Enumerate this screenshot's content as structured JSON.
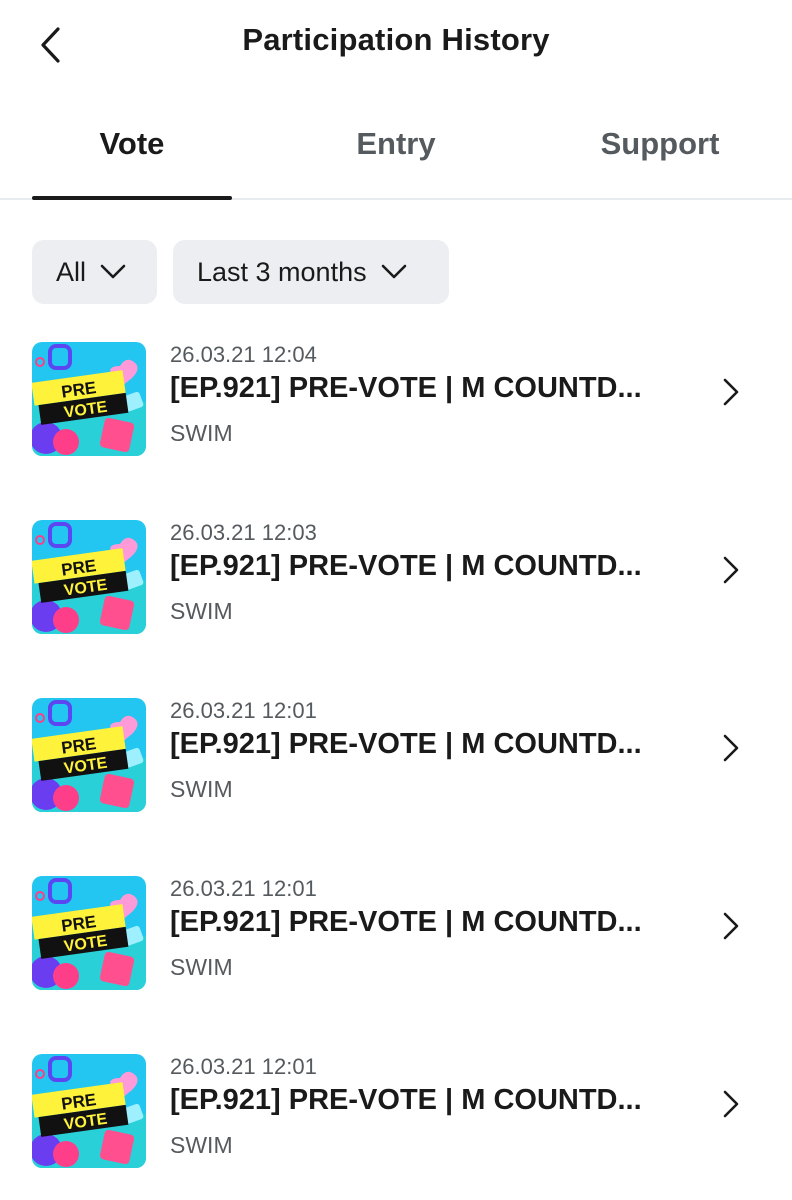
{
  "header": {
    "title": "Participation History",
    "back_icon": "chevron-left-icon"
  },
  "tabs": [
    {
      "label": "Vote",
      "active": true
    },
    {
      "label": "Entry",
      "active": false
    },
    {
      "label": "Support",
      "active": false
    }
  ],
  "filters": {
    "category": "All",
    "period": "Last 3 months",
    "icon": "chevron-down-icon"
  },
  "thumbnail": {
    "line1": "PRE",
    "line2": "VOTE"
  },
  "items": [
    {
      "date": "26.03.21 12:04",
      "title": "[EP.921] PRE-VOTE | M COUNTD...",
      "subtitle": "SWIM"
    },
    {
      "date": "26.03.21 12:03",
      "title": "[EP.921] PRE-VOTE | M COUNTD...",
      "subtitle": "SWIM"
    },
    {
      "date": "26.03.21 12:01",
      "title": "[EP.921] PRE-VOTE | M COUNTD...",
      "subtitle": "SWIM"
    },
    {
      "date": "26.03.21 12:01",
      "title": "[EP.921] PRE-VOTE | M COUNTD...",
      "subtitle": "SWIM"
    },
    {
      "date": "26.03.21 12:01",
      "title": "[EP.921] PRE-VOTE | M COUNTD...",
      "subtitle": "SWIM"
    }
  ],
  "colors": {
    "text_primary": "#1a1a1a",
    "text_secondary": "#555a5e",
    "chip_bg": "#eceef1",
    "divider": "#e9ecee",
    "thumb_bg": "#22c6f0",
    "thumb_band": "#fff23a"
  }
}
